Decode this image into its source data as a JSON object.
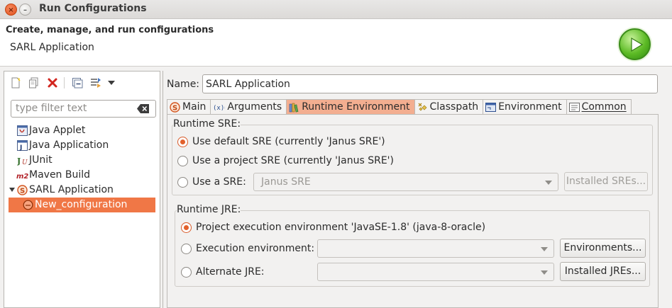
{
  "window": {
    "title": "Run Configurations"
  },
  "header": {
    "title": "Create, manage, and run configurations",
    "subtitle": "SARL Application"
  },
  "filter": {
    "placeholder": "type filter text"
  },
  "tree": [
    {
      "label": "Java Applet",
      "icon": "java-applet-icon",
      "indent": 0
    },
    {
      "label": "Java Application",
      "icon": "java-application-icon",
      "indent": 0
    },
    {
      "label": "JUnit",
      "icon": "junit-icon",
      "indent": 0
    },
    {
      "label": "Maven Build",
      "icon": "maven-icon",
      "indent": 0
    },
    {
      "label": "SARL Application",
      "icon": "sarl-icon",
      "indent": 0,
      "expanded": true
    },
    {
      "label": "New_configuration",
      "icon": "sarl-config-icon",
      "indent": 1,
      "selected": true
    }
  ],
  "form": {
    "name_label": "Name:",
    "name_value": "SARL Application"
  },
  "tabs": [
    {
      "label": "Main",
      "icon": "sarl-icon"
    },
    {
      "label": "Arguments",
      "icon": "arguments-icon"
    },
    {
      "label": "Runtime Environment",
      "icon": "library-icon",
      "active": true
    },
    {
      "label": "Classpath",
      "icon": "classpath-icon"
    },
    {
      "label": "Environment",
      "icon": "environment-icon"
    },
    {
      "label": "Common",
      "icon": "common-icon"
    }
  ],
  "sre": {
    "title": "Runtime SRE:",
    "option_default": "Use default SRE (currently 'Janus SRE')",
    "option_project": "Use a project SRE (currently 'Janus SRE')",
    "option_specific": "Use a SRE:",
    "combo_value": "Janus SRE",
    "installed_button": "Installed SREs..."
  },
  "jre": {
    "title": "Runtime JRE:",
    "option_project": "Project execution environment 'JavaSE-1.8' (java-8-oracle)",
    "option_exec_env": "Execution environment:",
    "option_alternate": "Alternate JRE:",
    "environments_button": "Environments...",
    "installed_button": "Installed JREs..."
  },
  "colors": {
    "accent": "#f07746",
    "active_tab": "#f3ae90",
    "run_green": "#5dbb26"
  }
}
